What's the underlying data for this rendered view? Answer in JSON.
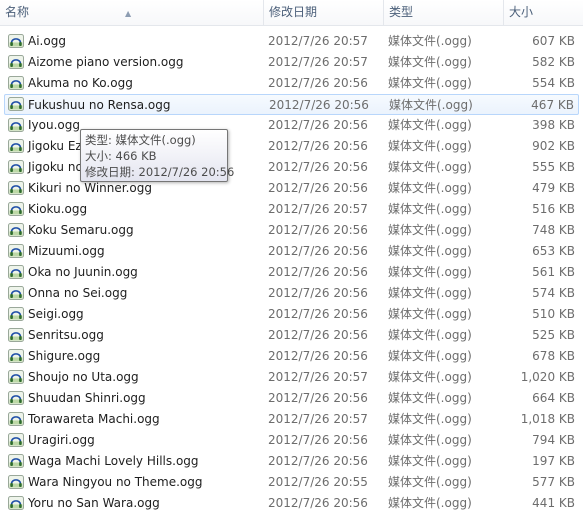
{
  "columns": {
    "name": "名称",
    "date": "修改日期",
    "type": "类型",
    "size": "大小"
  },
  "files": [
    {
      "name": "Ai.ogg",
      "date": "2012/7/26 20:57",
      "type": "媒体文件(.ogg)",
      "size": "607 KB"
    },
    {
      "name": "Aizome piano version.ogg",
      "date": "2012/7/26 20:57",
      "type": "媒体文件(.ogg)",
      "size": "582 KB"
    },
    {
      "name": "Akuma no Ko.ogg",
      "date": "2012/7/26 20:56",
      "type": "媒体文件(.ogg)",
      "size": "554 KB"
    },
    {
      "name": "Fukushuu no Rensa.ogg",
      "date": "2012/7/26 20:56",
      "type": "媒体文件(.ogg)",
      "size": "467 KB",
      "hover": true
    },
    {
      "name": "Iyou.ogg",
      "date": "2012/7/26 20:56",
      "type": "媒体文件(.ogg)",
      "size": "398 KB"
    },
    {
      "name": "Jigoku Ezu",
      "date": "2012/7/26 20:56",
      "type": "媒体文件(.ogg)",
      "size": "902 KB"
    },
    {
      "name": "Jigoku no",
      "date": "2012/7/26 20:56",
      "type": "媒体文件(.ogg)",
      "size": "555 KB"
    },
    {
      "name": "Kikuri no Winner.ogg",
      "date": "2012/7/26 20:56",
      "type": "媒体文件(.ogg)",
      "size": "479 KB"
    },
    {
      "name": "Kioku.ogg",
      "date": "2012/7/26 20:57",
      "type": "媒体文件(.ogg)",
      "size": "516 KB"
    },
    {
      "name": "Koku Semaru.ogg",
      "date": "2012/7/26 20:56",
      "type": "媒体文件(.ogg)",
      "size": "748 KB"
    },
    {
      "name": "Mizuumi.ogg",
      "date": "2012/7/26 20:56",
      "type": "媒体文件(.ogg)",
      "size": "653 KB"
    },
    {
      "name": "Oka no Juunin.ogg",
      "date": "2012/7/26 20:56",
      "type": "媒体文件(.ogg)",
      "size": "561 KB"
    },
    {
      "name": "Onna no Sei.ogg",
      "date": "2012/7/26 20:56",
      "type": "媒体文件(.ogg)",
      "size": "574 KB"
    },
    {
      "name": "Seigi.ogg",
      "date": "2012/7/26 20:56",
      "type": "媒体文件(.ogg)",
      "size": "510 KB"
    },
    {
      "name": "Senritsu.ogg",
      "date": "2012/7/26 20:56",
      "type": "媒体文件(.ogg)",
      "size": "525 KB"
    },
    {
      "name": "Shigure.ogg",
      "date": "2012/7/26 20:56",
      "type": "媒体文件(.ogg)",
      "size": "678 KB"
    },
    {
      "name": "Shoujo no Uta.ogg",
      "date": "2012/7/26 20:57",
      "type": "媒体文件(.ogg)",
      "size": "1,020 KB"
    },
    {
      "name": "Shuudan Shinri.ogg",
      "date": "2012/7/26 20:56",
      "type": "媒体文件(.ogg)",
      "size": "664 KB"
    },
    {
      "name": "Torawareta Machi.ogg",
      "date": "2012/7/26 20:57",
      "type": "媒体文件(.ogg)",
      "size": "1,018 KB"
    },
    {
      "name": "Uragiri.ogg",
      "date": "2012/7/26 20:56",
      "type": "媒体文件(.ogg)",
      "size": "794 KB"
    },
    {
      "name": "Waga Machi Lovely Hills.ogg",
      "date": "2012/7/26 20:56",
      "type": "媒体文件(.ogg)",
      "size": "197 KB"
    },
    {
      "name": "Wara Ningyou no Theme.ogg",
      "date": "2012/7/26 20:55",
      "type": "媒体文件(.ogg)",
      "size": "577 KB"
    },
    {
      "name": "Yoru no San Wara.ogg",
      "date": "2012/7/26 20:56",
      "type": "媒体文件(.ogg)",
      "size": "441 KB"
    }
  ],
  "file_icon": "headphones-media-icon",
  "tooltip": {
    "type_line": "类型: 媒体文件(.ogg)",
    "size_line": "大小: 466 KB",
    "date_line": "修改日期: 2012/7/26 20:56"
  }
}
